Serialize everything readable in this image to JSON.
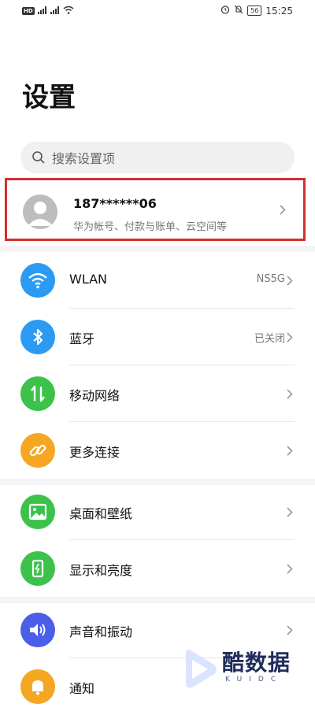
{
  "status_bar": {
    "left_badge": "HD",
    "left_signal_1": "⁴ᴳ",
    "left_signal_2": "⁴ᴳ",
    "battery": "56",
    "time": "15:25"
  },
  "page_title": "设置",
  "search": {
    "placeholder": "搜索设置项"
  },
  "account": {
    "name": "187******06",
    "subtitle": "华为帐号、付款与账单、云空间等"
  },
  "groups": [
    [
      {
        "label": "WLAN",
        "value": "NS5G",
        "icon": "wifi-icon",
        "color": "#2b9af3"
      },
      {
        "label": "蓝牙",
        "value": "已关闭",
        "icon": "bluetooth-icon",
        "color": "#2b9af3"
      },
      {
        "label": "移动网络",
        "value": "",
        "icon": "mobile-data-icon",
        "color": "#3cc24a"
      },
      {
        "label": "更多连接",
        "value": "",
        "icon": "link-icon",
        "color": "#f5a623"
      }
    ],
    [
      {
        "label": "桌面和壁纸",
        "value": "",
        "icon": "wallpaper-icon",
        "color": "#3cc24a"
      },
      {
        "label": "显示和亮度",
        "value": "",
        "icon": "display-icon",
        "color": "#3cc24a"
      }
    ],
    [
      {
        "label": "声音和振动",
        "value": "",
        "icon": "sound-icon",
        "color": "#4a5ee8"
      },
      {
        "label": "通知",
        "value": "",
        "icon": "notification-icon",
        "color": "#f5a623"
      }
    ]
  ],
  "watermark": {
    "text": "酷数据",
    "subtext": "KUIDC"
  }
}
